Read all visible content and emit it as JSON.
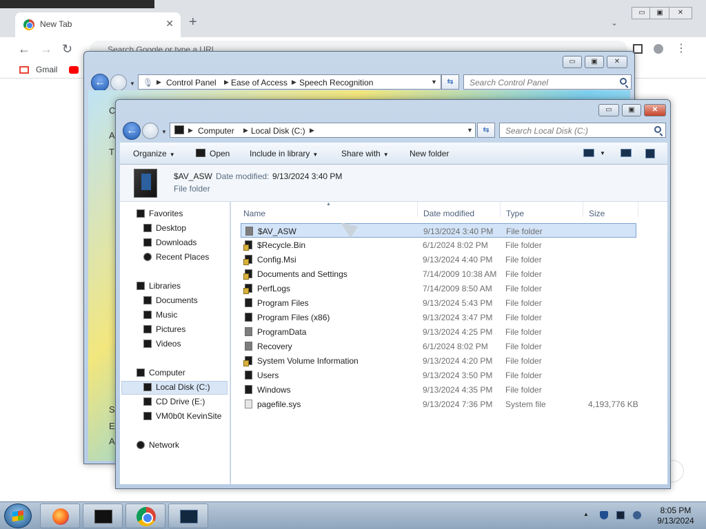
{
  "browser": {
    "tab_title": "New Tab",
    "omnibox_placeholder": "Search Google or type a URL",
    "bookmarks": [
      "Gmail"
    ]
  },
  "control_panel": {
    "breadcrumb": [
      "Control Panel",
      "Ease of Access",
      "Speech Recognition"
    ],
    "search_placeholder": "Search Control Panel",
    "side_letters": [
      "C",
      "A",
      "T",
      "S",
      "E",
      "A"
    ]
  },
  "explorer": {
    "breadcrumb": [
      "Computer",
      "Local Disk (C:)"
    ],
    "search_placeholder": "Search Local Disk (C:)",
    "toolbar": {
      "organize": "Organize",
      "open": "Open",
      "include_in_library": "Include in library",
      "share_with": "Share with",
      "new_folder": "New folder"
    },
    "details": {
      "name": "$AV_ASW",
      "date_label": "Date modified:",
      "date_value": "9/13/2024 3:40 PM",
      "type": "File folder"
    },
    "nav": {
      "favorites": "Favorites",
      "desktop": "Desktop",
      "downloads": "Downloads",
      "recent_places": "Recent Places",
      "libraries": "Libraries",
      "documents": "Documents",
      "music": "Music",
      "pictures": "Pictures",
      "videos": "Videos",
      "computer": "Computer",
      "local_disk": "Local Disk (C:)",
      "cd_drive": "CD Drive (E:)",
      "network_drive": "VM0b0t KevinSite",
      "network": "Network"
    },
    "columns": {
      "name": "Name",
      "date": "Date modified",
      "type": "Type",
      "size": "Size"
    },
    "rows": [
      {
        "name": "$AV_ASW",
        "date": "9/13/2024 3:40 PM",
        "type": "File folder",
        "size": ""
      },
      {
        "name": "$Recycle.Bin",
        "date": "6/1/2024 8:02 PM",
        "type": "File folder",
        "size": ""
      },
      {
        "name": "Config.Msi",
        "date": "9/13/2024 4:40 PM",
        "type": "File folder",
        "size": ""
      },
      {
        "name": "Documents and Settings",
        "date": "7/14/2009 10:38 AM",
        "type": "File folder",
        "size": ""
      },
      {
        "name": "PerfLogs",
        "date": "7/14/2009 8:50 AM",
        "type": "File folder",
        "size": ""
      },
      {
        "name": "Program Files",
        "date": "9/13/2024 5:43 PM",
        "type": "File folder",
        "size": ""
      },
      {
        "name": "Program Files (x86)",
        "date": "9/13/2024 3:47 PM",
        "type": "File folder",
        "size": ""
      },
      {
        "name": "ProgramData",
        "date": "9/13/2024 4:25 PM",
        "type": "File folder",
        "size": ""
      },
      {
        "name": "Recovery",
        "date": "6/1/2024 8:02 PM",
        "type": "File folder",
        "size": ""
      },
      {
        "name": "System Volume Information",
        "date": "9/13/2024 4:20 PM",
        "type": "File folder",
        "size": ""
      },
      {
        "name": "Users",
        "date": "9/13/2024 3:50 PM",
        "type": "File folder",
        "size": ""
      },
      {
        "name": "Windows",
        "date": "9/13/2024 4:35 PM",
        "type": "File folder",
        "size": ""
      },
      {
        "name": "pagefile.sys",
        "date": "9/13/2024 7:36 PM",
        "type": "System file",
        "size": "4,193,776 KB"
      }
    ]
  },
  "taskbar": {
    "time": "8:05 PM",
    "date": "9/13/2024"
  }
}
